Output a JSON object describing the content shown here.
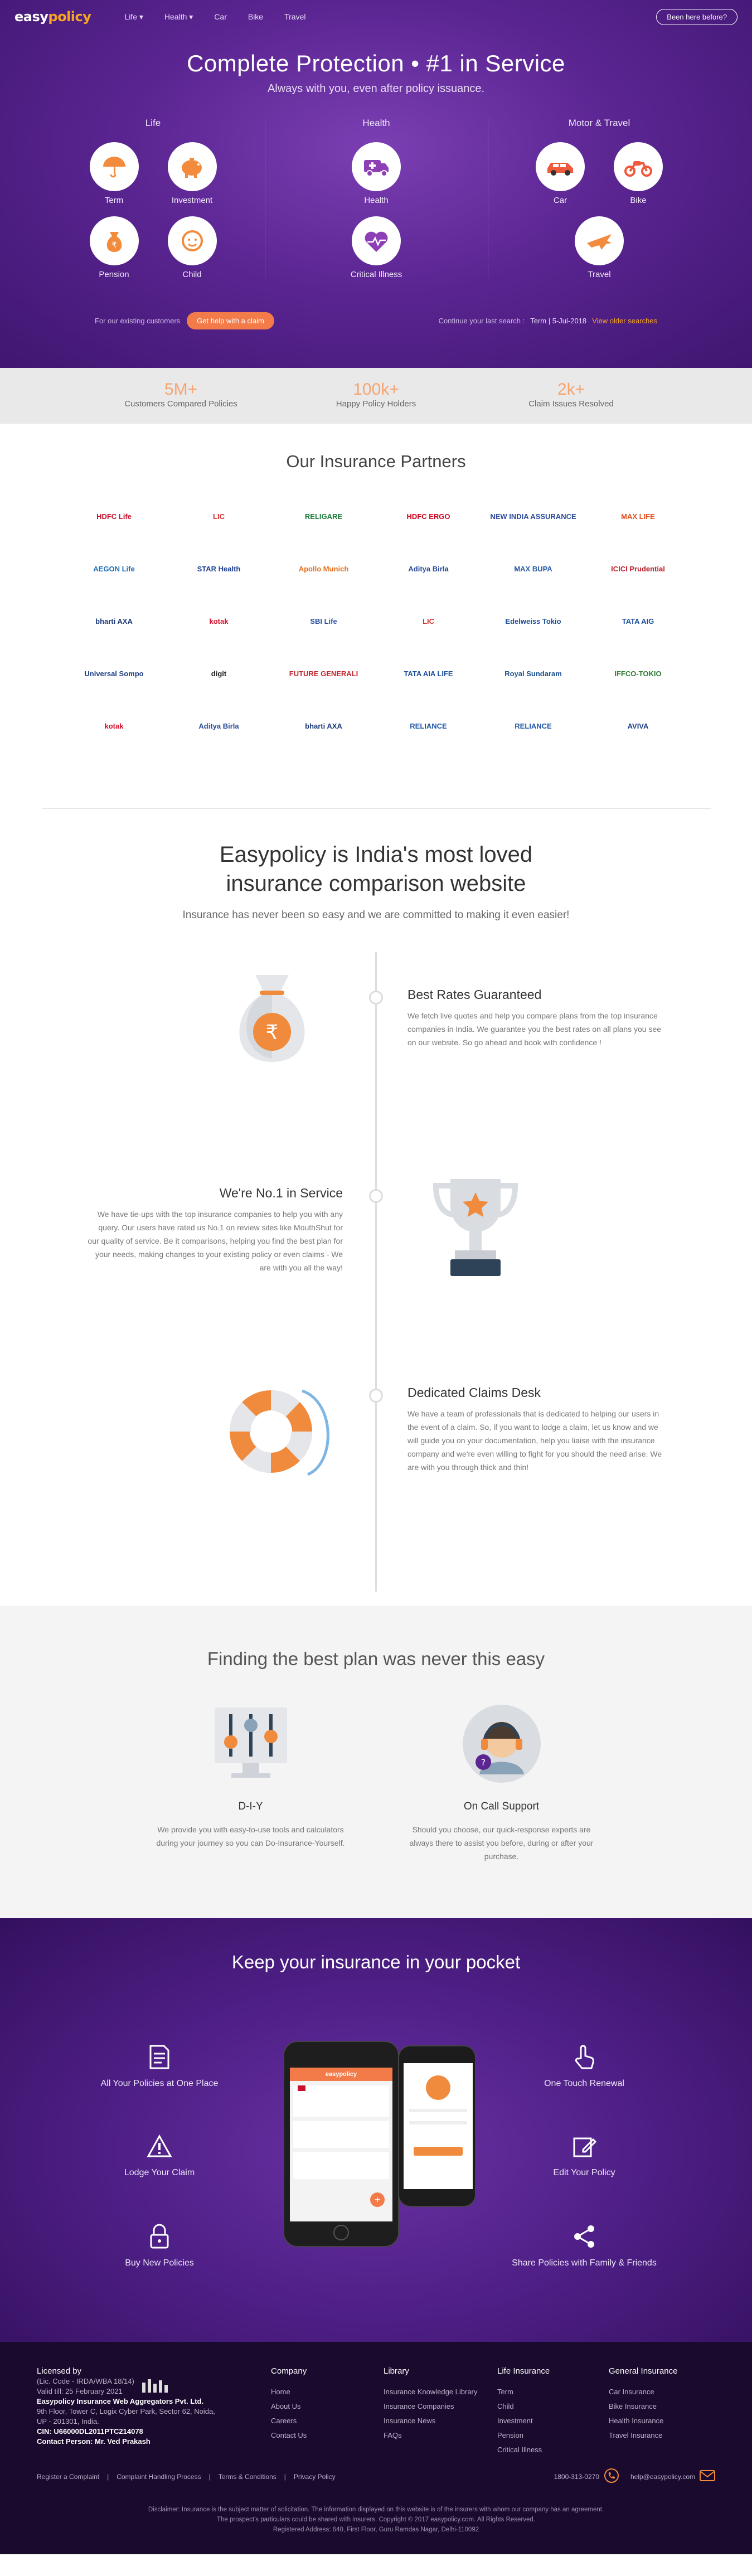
{
  "nav": {
    "logo_a": "easy",
    "logo_b": "policy",
    "links": [
      "Life ▾",
      "Health ▾",
      "Car",
      "Bike",
      "Travel"
    ],
    "been_here": "Been here before?"
  },
  "hero": {
    "title": "Complete Protection • #1 in Service",
    "subtitle": "Always with you, even after policy issuance.",
    "categories": [
      {
        "name": "Life",
        "products": [
          "Term",
          "Investment",
          "Pension",
          "Child"
        ]
      },
      {
        "name": "Health",
        "products": [
          "Health",
          "Critical Illness"
        ]
      },
      {
        "name": "Motor & Travel",
        "products": [
          "Car",
          "Bike",
          "Travel"
        ]
      }
    ],
    "existing_label": "For our existing customers",
    "claim_button": "Get help with a claim",
    "continue_label": "Continue your last search :",
    "last_search": "Term | 5-Jul-2018",
    "view_older": "View older searches"
  },
  "stats": [
    {
      "value": "5M+",
      "label": "Customers Compared Policies"
    },
    {
      "value": "100k+",
      "label": "Happy Policy Holders"
    },
    {
      "value": "2k+",
      "label": "Claim Issues Resolved"
    }
  ],
  "partners": {
    "title": "Our Insurance Partners",
    "logos": [
      {
        "text": "HDFC Life",
        "color": "#c8102e"
      },
      {
        "text": "LIC",
        "color": "#d62e2e"
      },
      {
        "text": "RELIGARE",
        "color": "#1b7a3a"
      },
      {
        "text": "HDFC ERGO",
        "color": "#d0021b"
      },
      {
        "text": "NEW INDIA ASSURANCE",
        "color": "#2a4b9b"
      },
      {
        "text": "MAX LIFE",
        "color": "#e04e1b"
      },
      {
        "text": "AEGON Life",
        "color": "#1f6fb6"
      },
      {
        "text": "STAR Health",
        "color": "#1d3f8f"
      },
      {
        "text": "Apollo Munich",
        "color": "#e36f1e"
      },
      {
        "text": "Aditya Birla",
        "color": "#2b4c96"
      },
      {
        "text": "MAX BUPA",
        "color": "#2a5aa8"
      },
      {
        "text": "ICICI Prudential",
        "color": "#b8232f"
      },
      {
        "text": "bharti AXA",
        "color": "#1e3a7a"
      },
      {
        "text": "kotak",
        "color": "#d0112b"
      },
      {
        "text": "SBI Life",
        "color": "#2a4fa1"
      },
      {
        "text": "LIC",
        "color": "#d62e2e"
      },
      {
        "text": "Edelweiss Tokio",
        "color": "#1f4f9a"
      },
      {
        "text": "TATA AIG",
        "color": "#1b4f9b"
      },
      {
        "text": "Universal Sompo",
        "color": "#1e3f86"
      },
      {
        "text": "digit",
        "color": "#222222"
      },
      {
        "text": "FUTURE GENERALI",
        "color": "#c0262d"
      },
      {
        "text": "TATA AIA LIFE",
        "color": "#1b4f9b"
      },
      {
        "text": "Royal Sundaram",
        "color": "#1d4f8f"
      },
      {
        "text": "IFFCO-TOKIO",
        "color": "#2e7d32"
      },
      {
        "text": "kotak",
        "color": "#d0112b"
      },
      {
        "text": "Aditya Birla",
        "color": "#2b4c96"
      },
      {
        "text": "bharti AXA",
        "color": "#1e3a7a"
      },
      {
        "text": "RELIANCE",
        "color": "#1f56a8"
      },
      {
        "text": "RELIANCE",
        "color": "#1f56a8"
      },
      {
        "text": "AVIVA",
        "color": "#1b3f86"
      }
    ]
  },
  "why": {
    "title_line1": "Easypolicy is India's most loved",
    "title_line2": "insurance comparison website",
    "tagline": "Insurance has never been so easy and we are committed to making it even easier!",
    "features": [
      {
        "title": "Best Rates Guaranteed",
        "text": "We fetch live quotes and help you compare plans from the top insurance companies in India. We guarantee you the best rates on all plans you see on our website. So go ahead and book with confidence !"
      },
      {
        "title": "We're No.1 in Service",
        "text": "We have tie-ups with the top insurance companies to help you with any query. Our users have rated us No.1 on review sites like MouthShut for our quality of service. Be it comparisons, helping you find the best plan for your needs, making changes to your existing policy or even claims - We are with you all the way!"
      },
      {
        "title": "Dedicated Claims Desk",
        "text": "We have a team of professionals that is dedicated to helping our users in the event of a claim. So, if you want to lodge a claim, let us know and we will guide you on your documentation, help you liaise with the insurance company and we're even willing to fight for you should the need arise. We are with you through thick and thin!"
      }
    ]
  },
  "plan": {
    "title": "Finding the best plan was never this easy",
    "cols": [
      {
        "title": "D-I-Y",
        "text": "We provide you with easy-to-use tools and calculators during your journey so you can Do-Insurance-Yourself."
      },
      {
        "title": "On Call Support",
        "text": "Should you choose, our quick-response experts are always there to assist you before, during or after your purchase."
      }
    ]
  },
  "app": {
    "title": "Keep your insurance in your pocket",
    "features": [
      "All Your Policies at One Place",
      "Lodge Your Claim",
      "Buy New Policies",
      "One Touch Renewal",
      "Edit Your Policy",
      "Share Policies with Family & Friends"
    ],
    "phone_logo": "easypolicy"
  },
  "footer": {
    "license_title": "Licensed by",
    "license_lines": [
      "(Lic. Code - IRDA/WBA 18/14)",
      "Valid till: 25 February 2021"
    ],
    "company_name": "Easypolicy Insurance Web Aggregators Pvt. Ltd.",
    "address": "9th Floor, Tower C, Logix Cyber Park, Sector 62, Noida, UP - 201301, India.",
    "cin": "CIN: U66000DL2011PTC214078",
    "contact": "Contact Person: Mr. Ved Prakash",
    "columns": [
      {
        "title": "Company",
        "items": [
          "Home",
          "About Us",
          "Careers",
          "Contact Us"
        ]
      },
      {
        "title": "Library",
        "items": [
          "Insurance Knowledge Library",
          "Insurance Companies",
          "Insurance News",
          "FAQs"
        ]
      },
      {
        "title": "Life Insurance",
        "items": [
          "Term",
          "Child",
          "Investment",
          "Pension",
          "Critical Illness"
        ]
      },
      {
        "title": "General Insurance",
        "items": [
          "Car Insurance",
          "Bike Insurance",
          "Health Insurance",
          "Travel Insurance"
        ]
      }
    ],
    "bottom_links": [
      "Register a Complaint",
      "|",
      "Complaint Handling Process",
      "|",
      "Terms & Conditions",
      "|",
      "Privacy Policy"
    ],
    "phone": "1800-313-0270",
    "email": "help@easypolicy.com",
    "legal1": "Disclaimer: Insurance is the subject matter of solicitation. The information displayed on this website is of the insurers with whom our company has an agreement.",
    "legal2": "The prospect's particulars could be shared with insurers. Copyright © 2017 easypolicy.com. All Rights Reserved.",
    "legal3": "Registered Address: 640, First Floor, Guru Ramdas Nagar, Delhi-110092"
  }
}
